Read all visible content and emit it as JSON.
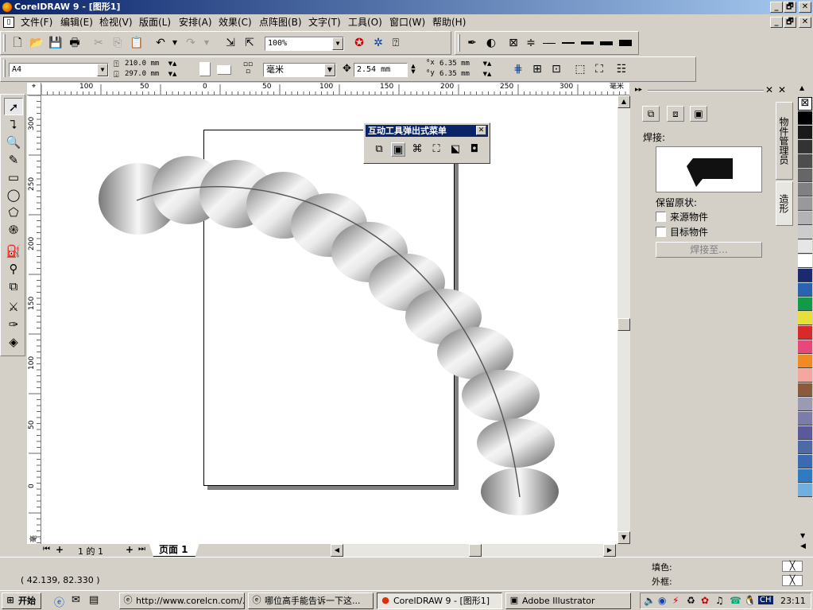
{
  "window": {
    "title": "CorelDRAW 9 - [图形1]",
    "min": "_",
    "max": "🗗",
    "close": "✕"
  },
  "menu": [
    "文件(F)",
    "编辑(E)",
    "检视(V)",
    "版面(L)",
    "安排(A)",
    "效果(C)",
    "点阵图(B)",
    "文字(T)",
    "工具(O)",
    "窗口(W)",
    "帮助(H)"
  ],
  "toolbar": {
    "zoom": "100%"
  },
  "property_bar": {
    "paper": "A4",
    "width": "210.0 mm",
    "height": "297.0 mm",
    "units": "毫米",
    "nudge": "2.54 mm",
    "dup_x": "6.35 mm",
    "dup_y": "6.35 mm"
  },
  "ruler": {
    "h_labels": [
      "100",
      "50",
      "0",
      "50",
      "100",
      "150",
      "200",
      "250",
      "300"
    ],
    "h_unit": "毫米",
    "v_labels": [
      "300",
      "250",
      "200",
      "150",
      "100",
      "50",
      "0"
    ],
    "v_unit": "毫米"
  },
  "popup": {
    "title": "互动工具弹出式菜单",
    "close": "✕"
  },
  "page_nav": {
    "position": "1 的 1",
    "tab": "页面 1"
  },
  "docker": {
    "section_label": "焊接:",
    "keep_label": "保留原状:",
    "option_source": "来源物件",
    "option_target": "目标物件",
    "button": "焊接至...",
    "tab_manager": "物件管理员",
    "tab_shape": "造形"
  },
  "palette": [
    "#ffffff",
    "#000000",
    "#1a1a1a",
    "#333333",
    "#4d4d4d",
    "#666666",
    "#808080",
    "#999999",
    "#b3b3b3",
    "#cccccc",
    "#e6e6e6",
    "#ffffff",
    "#1b2a6e",
    "#2b63b3",
    "#119a4a",
    "#e8e03a",
    "#d82a2a",
    "#e7487a",
    "#f08a24",
    "#f4a7a0",
    "#8a5a3a",
    "#9a9ab5",
    "#7c7cab",
    "#5a5a9a",
    "#4d6aa5",
    "#3a6ab0",
    "#2f7ac0",
    "#6fb0e0"
  ],
  "status": {
    "coords": "( 42.139, 82.330 )",
    "fill_label": "填色:",
    "outline_label": "外框:"
  },
  "taskbar": {
    "start": "开始",
    "tasks": [
      "http://www.corelcn.com/...",
      "哪位高手能告诉一下这...",
      "CorelDRAW 9 - [图形1]",
      "Adobe Illustrator"
    ],
    "lang": "CH",
    "clock": "23:11"
  }
}
